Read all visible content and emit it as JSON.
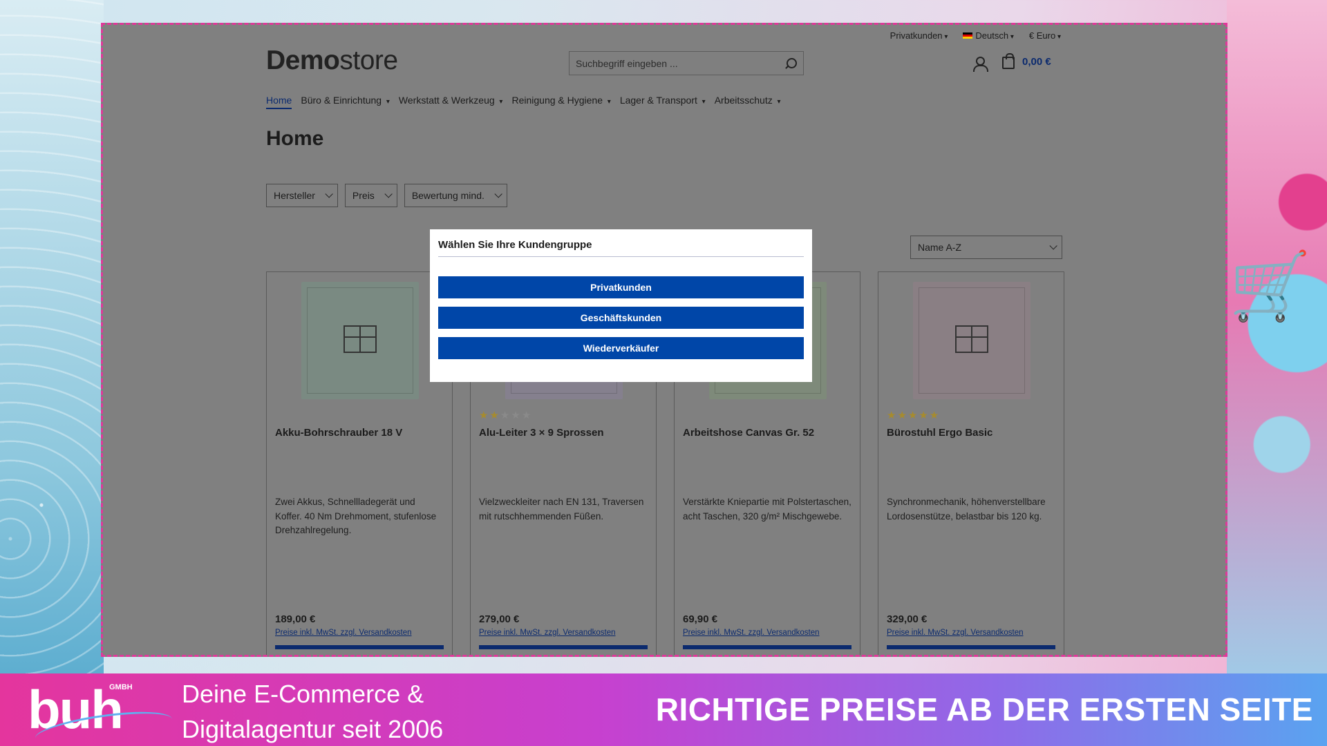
{
  "topbar": {
    "customer_group": "Privatkunden",
    "language": "Deutsch",
    "currency": "€ Euro"
  },
  "logo": {
    "bold": "Demo",
    "light": "store"
  },
  "search": {
    "placeholder": "Suchbegriff eingeben ..."
  },
  "cart": {
    "total": "0,00 €"
  },
  "nav": [
    {
      "label": "Home",
      "active": true
    },
    {
      "label": "Büro & Einrichtung"
    },
    {
      "label": "Werkstatt & Werkzeug"
    },
    {
      "label": "Reinigung & Hygiene"
    },
    {
      "label": "Lager & Transport"
    },
    {
      "label": "Arbeitsschutz"
    }
  ],
  "page_title": "Home",
  "filters": [
    "Hersteller",
    "Preis",
    "Bewertung mind."
  ],
  "sort": {
    "selected": "Name A-Z"
  },
  "products": [
    {
      "name": "Akku-Bohrschrauber 18 V",
      "desc": "Zwei Akkus, Schnellladegerät und Koffer. 40 Nm Drehmoment, stufenlose Drehzahlregelung.",
      "price": "189,00 €",
      "tax": "Preise inkl. MwSt. zzgl. Versandkosten",
      "rating": 0,
      "img_color": "#7a8a82"
    },
    {
      "name": "Alu-Leiter 3 × 9 Sprossen",
      "desc": "Vielzweckleiter nach EN 131, Traversen mit rutschhemmenden Füßen.",
      "price": "279,00 €",
      "tax": "Preise inkl. MwSt. zzgl. Versandkosten",
      "rating": 2,
      "img_color": "#85808e"
    },
    {
      "name": "Arbeitshose Canvas Gr. 52",
      "desc": "Verstärkte Kniepartie mit Polstertaschen, acht Taschen, 320 g/m² Mischgewebe.",
      "price": "69,90 €",
      "tax": "Preise inkl. MwSt. zzgl. Versandkosten",
      "rating": 0,
      "img_color": "#7e8a7a"
    },
    {
      "name": "Bürostuhl Ergo Basic",
      "desc": "Synchronmechanik, höhenverstellbare Lordosenstütze, belastbar bis 120 kg.",
      "price": "329,00 €",
      "tax": "Preise inkl. MwSt. zzgl. Versandkosten",
      "rating": 5,
      "img_color": "#8a7f84"
    }
  ],
  "modal": {
    "title": "Wählen Sie Ihre Kundengruppe",
    "options": [
      "Privatkunden",
      "Geschäftskunden",
      "Wiederverkäufer"
    ]
  },
  "banner": {
    "brand": "buh",
    "brand_suffix": "GMBH",
    "tagline_line1": "Deine E-Commerce &",
    "tagline_line2": "Digitalagentur seit 2006",
    "headline": "RICHTIGE PREISE AB DER ERSTEN SEITE"
  },
  "colors": {
    "accent_blue": "#0046a8",
    "frame_dash": "#e0389a",
    "overlay_gray": "#808080"
  }
}
